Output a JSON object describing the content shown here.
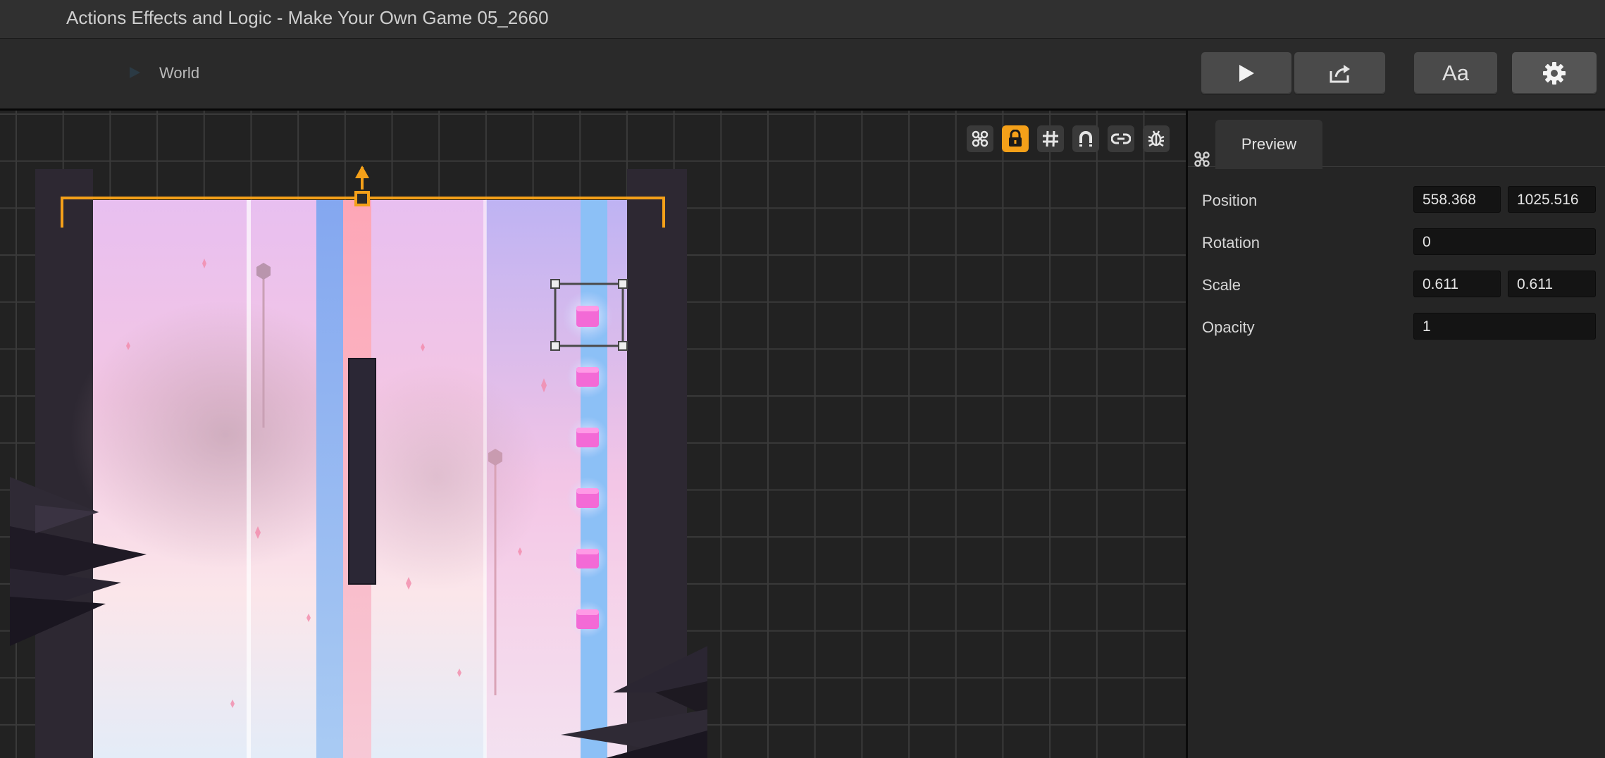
{
  "window": {
    "title": "Actions Effects and Logic - Make Your Own Game 05_2660"
  },
  "breadcrumb": {
    "label": "World",
    "icon": "play-arrow-icon"
  },
  "toolbar": {
    "play_icon": "play-icon",
    "share_icon": "share-icon",
    "font_label": "Aa",
    "settings_icon": "gear-icon"
  },
  "viewport_tools": [
    {
      "name": "transform-icon",
      "active": false
    },
    {
      "name": "lock-icon",
      "active": true
    },
    {
      "name": "grid-icon",
      "active": false
    },
    {
      "name": "magnet-icon",
      "active": false
    },
    {
      "name": "link-icon",
      "active": false
    },
    {
      "name": "debug-icon",
      "active": false
    }
  ],
  "colors": {
    "accent": "#f4a019",
    "selection": "#4a4a4a"
  },
  "inspector": {
    "tab_label": "Preview",
    "position": {
      "label": "Position",
      "x": "558.368",
      "y": "1025.516"
    },
    "rotation": {
      "label": "Rotation",
      "value": "0"
    },
    "scale": {
      "label": "Scale",
      "x": "0.611",
      "y": "0.611"
    },
    "opacity": {
      "label": "Opacity",
      "value": "1"
    }
  }
}
